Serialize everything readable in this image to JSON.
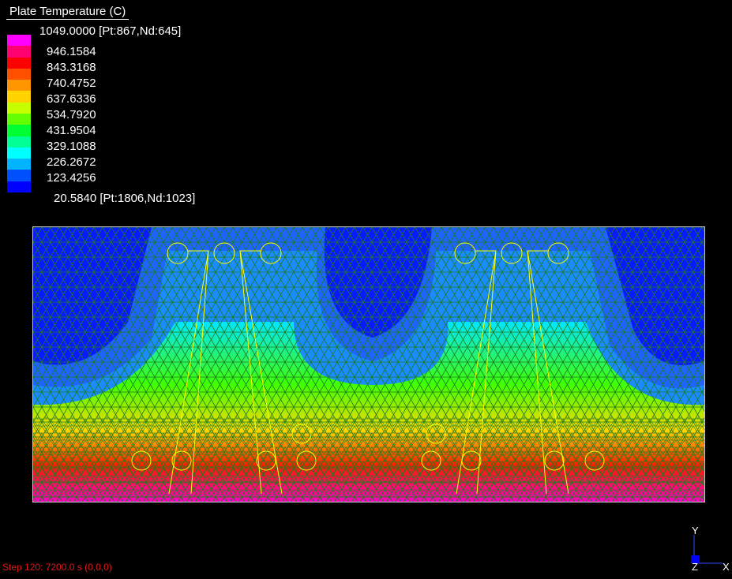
{
  "legend": {
    "title": "Plate Temperature  (C)",
    "max_label": "1049.0000 [Pt:867,Nd:645]",
    "min_label": "20.5840 [Pt:1806,Nd:1023]",
    "ticks": [
      "946.1584",
      "843.3168",
      "740.4752",
      "637.6336",
      "534.7920",
      "431.9504",
      "329.1088",
      "226.2672",
      "123.4256"
    ],
    "colors": [
      "#ff00ff",
      "#ff0070",
      "#ff0000",
      "#ff5000",
      "#ff9600",
      "#ffd200",
      "#c8ff00",
      "#64ff00",
      "#00ff32",
      "#00ff96",
      "#00ffff",
      "#00b4ff",
      "#0050ff",
      "#0000ff"
    ]
  },
  "viewport": {
    "colors": {
      "background_cool": "#0a1aff",
      "band_light_blue": "#1e64ff",
      "band_cyan": "#00e6ff",
      "band_green": "#40ff00",
      "band_yellow": "#ffd800",
      "band_red": "#ff1a00",
      "band_magenta": "#ff00c8",
      "mesh": "#1d7a1d",
      "outline": "#ffff00"
    }
  },
  "triad": {
    "y_label": "Y",
    "z_label": "Z",
    "x_label": "X"
  },
  "status": {
    "text": "Step 120: 7200.0 s (0,0,0)"
  }
}
